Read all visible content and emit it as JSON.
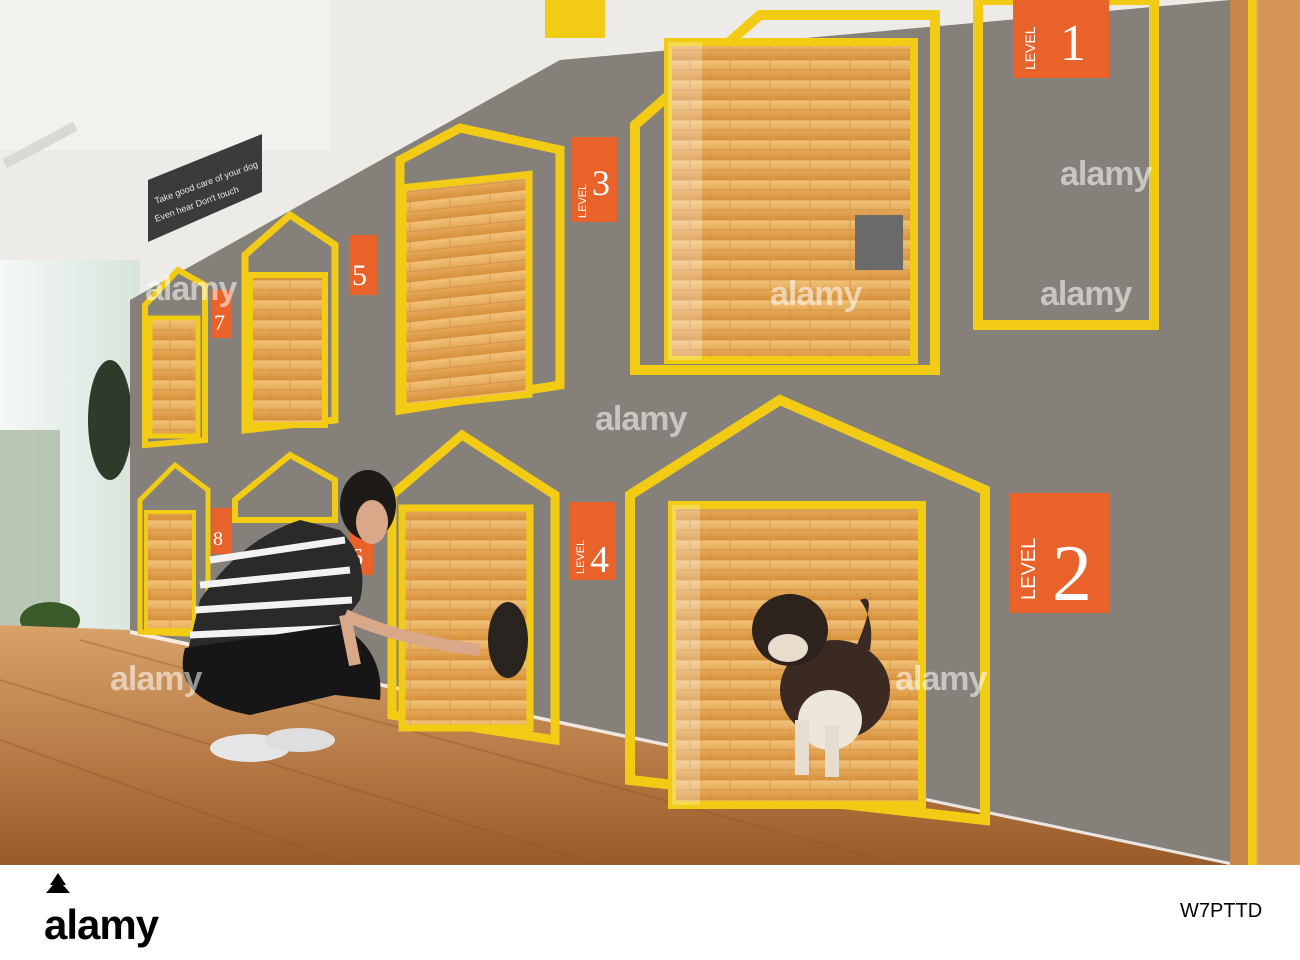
{
  "photo": {
    "sign_text": [
      "Take good care of your dog",
      "Even hear Don't touch"
    ],
    "kennel_badges": [
      {
        "word": "LEVEL",
        "number": "1"
      },
      {
        "word": "LEVEL",
        "number": "2"
      },
      {
        "word": "LEVEL",
        "number": "3"
      },
      {
        "word": "LEVEL",
        "number": "4"
      },
      {
        "word": "",
        "number": "5"
      },
      {
        "word": "",
        "number": "6"
      },
      {
        "word": "",
        "number": "7"
      },
      {
        "word": "",
        "number": "8"
      }
    ],
    "watermark": "alamy"
  },
  "footer": {
    "logo_text": "alamy",
    "image_id": "W7PTTD",
    "logo_color": "#000000",
    "background_color": "#ffffff"
  },
  "colors": {
    "wall": "#85807a",
    "frame_yellow": "#f2cc14",
    "badge_orange": "#e8622a",
    "tile": "#e6a850",
    "floor": "#c48244"
  }
}
